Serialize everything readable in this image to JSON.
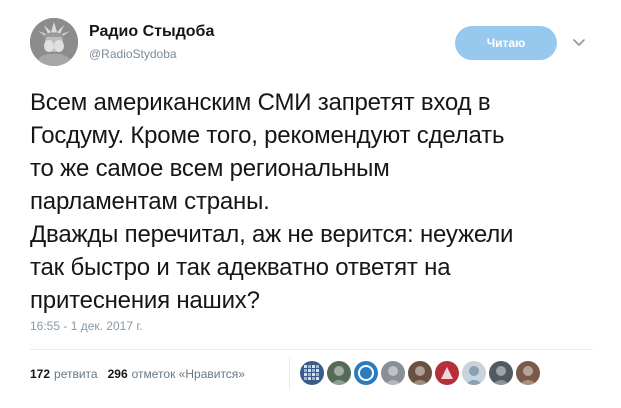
{
  "author": {
    "name": "Радио Стыдоба",
    "handle": "@RadioStydoba"
  },
  "follow_button": {
    "label": "Читаю"
  },
  "tweet": {
    "lines": [
      "Всем американским СМИ запретят вход в",
      "Госдуму. Кроме того, рекомендуют сделать",
      "то же самое всем региональным",
      "парламентам страны.",
      "Дважды перечитал, аж не верится: неужели",
      "так быстро и так адекватно ответят на",
      "притеснения наших?"
    ],
    "timestamp": "16:55 - 1 дек. 2017 г."
  },
  "stats": {
    "retweets_count": "172",
    "retweets_label": "ретвита",
    "likes_count": "296",
    "likes_label": "отметок «Нравится»"
  },
  "likers": [
    {
      "icon": "avatar-grid-icon",
      "color": "#3b5b8a"
    },
    {
      "icon": "avatar-photo-icon",
      "color": "#556b5a"
    },
    {
      "icon": "avatar-blue-icon",
      "color": "#2b7bbf"
    },
    {
      "icon": "avatar-photo-icon",
      "color": "#8a8f96"
    },
    {
      "icon": "avatar-photo-icon",
      "color": "#6a5040"
    },
    {
      "icon": "avatar-red-icon",
      "color": "#b5303a"
    },
    {
      "icon": "avatar-light-icon",
      "color": "#c9d3dc"
    },
    {
      "icon": "avatar-photo-icon",
      "color": "#505a60"
    },
    {
      "icon": "avatar-photo-icon",
      "color": "#7a5a48"
    }
  ],
  "colors": {
    "follow_bg": "#97c9ef",
    "text": "#14171a",
    "muted": "#657786",
    "divider": "#e6ecf0"
  }
}
